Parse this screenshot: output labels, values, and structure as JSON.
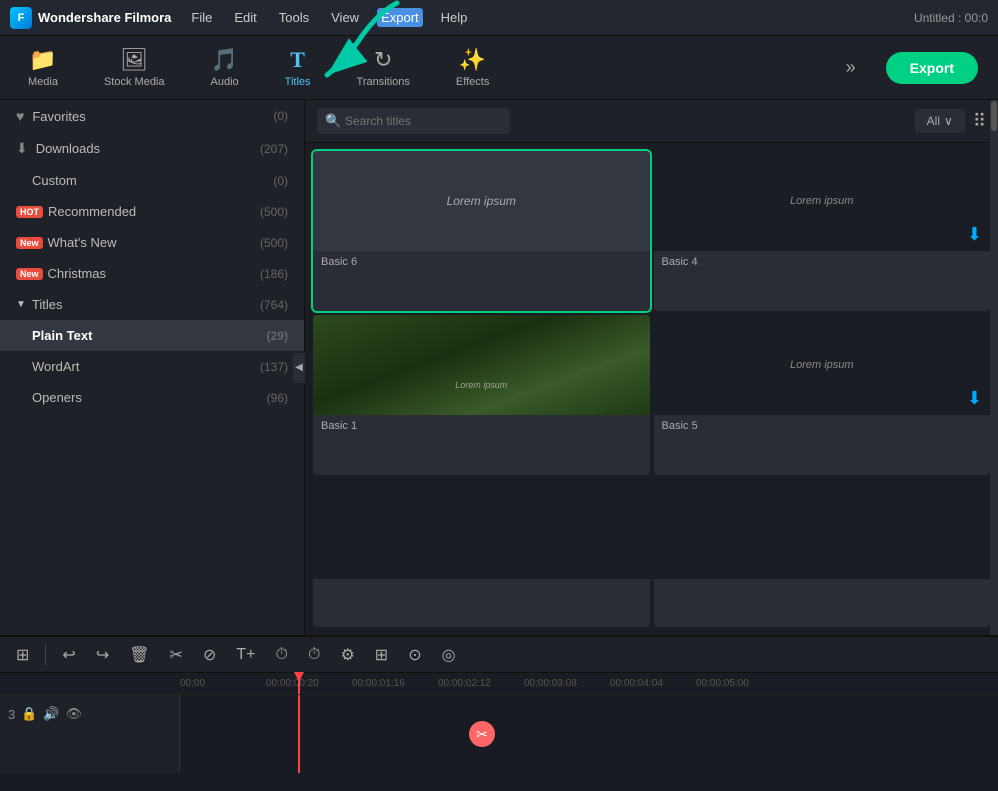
{
  "app": {
    "name": "Wondershare Filmora",
    "title": "Untitled : 00:0"
  },
  "menu": {
    "items": [
      "File",
      "Edit",
      "Tools",
      "View",
      "Export",
      "Help"
    ],
    "active": "Export"
  },
  "toolbar": {
    "items": [
      {
        "id": "media",
        "icon": "📁",
        "label": "Media"
      },
      {
        "id": "stock-media",
        "icon": "🖼",
        "label": "Stock Media"
      },
      {
        "id": "audio",
        "icon": "🎵",
        "label": "Audio"
      },
      {
        "id": "titles",
        "icon": "T",
        "label": "Titles"
      },
      {
        "id": "transitions",
        "icon": "↻",
        "label": "Transitions"
      },
      {
        "id": "effects",
        "icon": "✨",
        "label": "Effects"
      }
    ],
    "more": "»",
    "export_label": "Export"
  },
  "sidebar": {
    "items": [
      {
        "id": "favorites",
        "icon": "♥",
        "label": "Favorites",
        "count": "(0)"
      },
      {
        "id": "downloads",
        "icon": "⬇",
        "label": "Downloads",
        "count": "(207)"
      },
      {
        "id": "custom",
        "icon": "",
        "label": "Custom",
        "count": "(0)",
        "indent": true
      },
      {
        "id": "recommended",
        "badge": "HOT",
        "badge_type": "hot",
        "label": "Recommended",
        "count": "(500)"
      },
      {
        "id": "whats-new",
        "badge": "New",
        "badge_type": "new",
        "label": "What's New",
        "count": "(500)"
      },
      {
        "id": "christmas",
        "badge": "New",
        "badge_type": "new",
        "label": "Christmas",
        "count": "(186)"
      },
      {
        "id": "titles",
        "icon": "▼",
        "label": "Titles",
        "count": "(764)"
      },
      {
        "id": "plain-text",
        "label": "Plain Text",
        "count": "(29)",
        "active": true
      },
      {
        "id": "wordart",
        "label": "WordArt",
        "count": "(137)",
        "indent": true
      },
      {
        "id": "openers",
        "label": "Openers",
        "count": "(96)",
        "indent": true
      }
    ]
  },
  "search": {
    "placeholder": "Search titles",
    "filter_label": "All",
    "filter_arrow": "∨"
  },
  "grid": {
    "items": [
      {
        "id": "basic6",
        "label": "Basic 6",
        "type": "text",
        "text": "Lorem ipsum",
        "selected": true
      },
      {
        "id": "basic4",
        "label": "Basic 4",
        "type": "download",
        "text": "Lorem ipsum"
      },
      {
        "id": "basic1",
        "label": "Basic 1",
        "type": "photo",
        "text": "Lorem ipsum"
      },
      {
        "id": "basic5",
        "label": "Basic 5",
        "type": "download-dark",
        "text": "Lorem ipsum"
      },
      {
        "id": "item5",
        "label": "",
        "type": "empty"
      },
      {
        "id": "item6",
        "label": "",
        "type": "empty"
      }
    ]
  },
  "timeline": {
    "toolbar_buttons": [
      "⊞",
      "|",
      "↩",
      "↪",
      "🗑",
      "✂",
      "⊘",
      "T+",
      "⏱",
      "⏱",
      "⚙",
      "⊞",
      "⊙",
      "◎"
    ],
    "ruler_marks": [
      "00:00",
      "00:00:00:20",
      "00:00:01:16",
      "00:00:02:12",
      "00:00:03:08",
      "00:00:04:04",
      "00:00:05:00"
    ],
    "tracks": [
      {
        "id": "track1",
        "icons": [
          "3",
          "🔒",
          "🔊",
          "👁"
        ]
      }
    ]
  }
}
